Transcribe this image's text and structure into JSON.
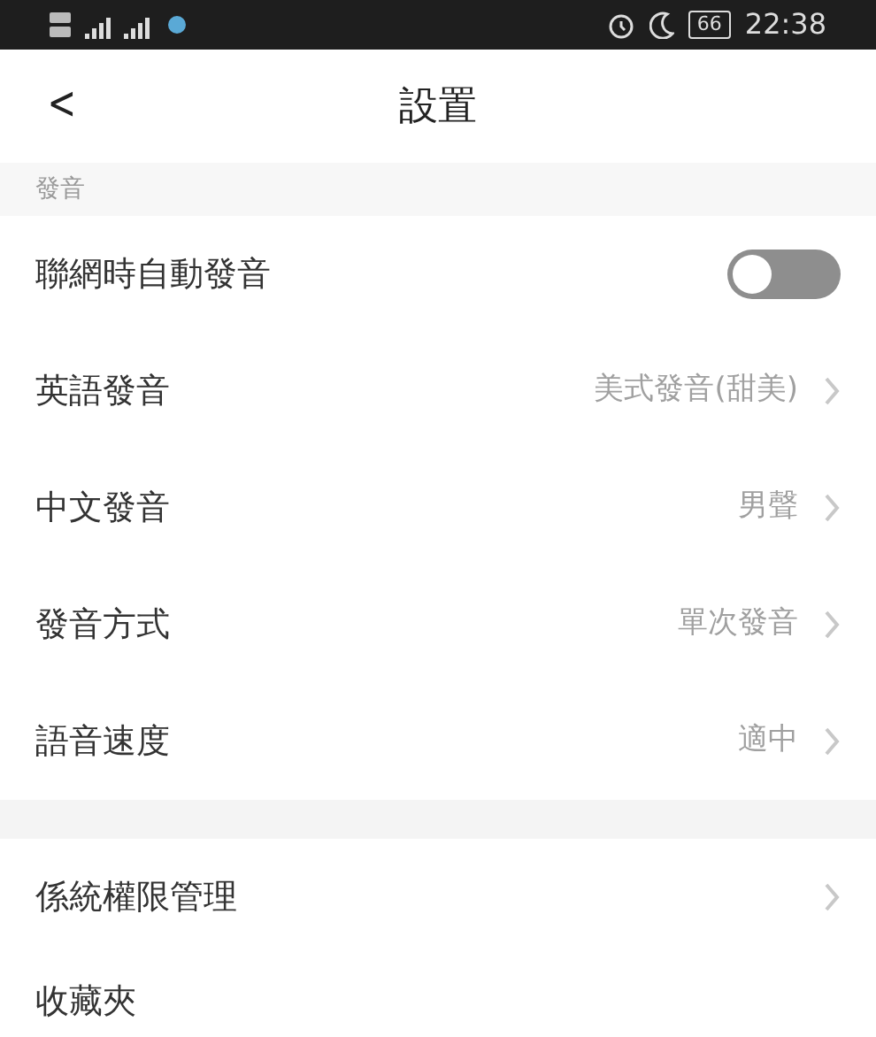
{
  "status_bar": {
    "battery": "66",
    "time": "22:38"
  },
  "header": {
    "back": "<",
    "title": "設置"
  },
  "sections": [
    {
      "label": "發音",
      "rows": [
        {
          "kind": "toggle",
          "label": "聯網時自動發音",
          "on": false
        },
        {
          "kind": "value",
          "label": "英語發音",
          "value": "美式發音(甜美)"
        },
        {
          "kind": "value",
          "label": "中文發音",
          "value": "男聲"
        },
        {
          "kind": "value",
          "label": "發音方式",
          "value": "單次發音"
        },
        {
          "kind": "value",
          "label": "語音速度",
          "value": "適中"
        }
      ]
    },
    {
      "rows": [
        {
          "kind": "link",
          "label": "係統權限管理"
        },
        {
          "kind": "link",
          "label": "收藏夾"
        }
      ]
    }
  ]
}
